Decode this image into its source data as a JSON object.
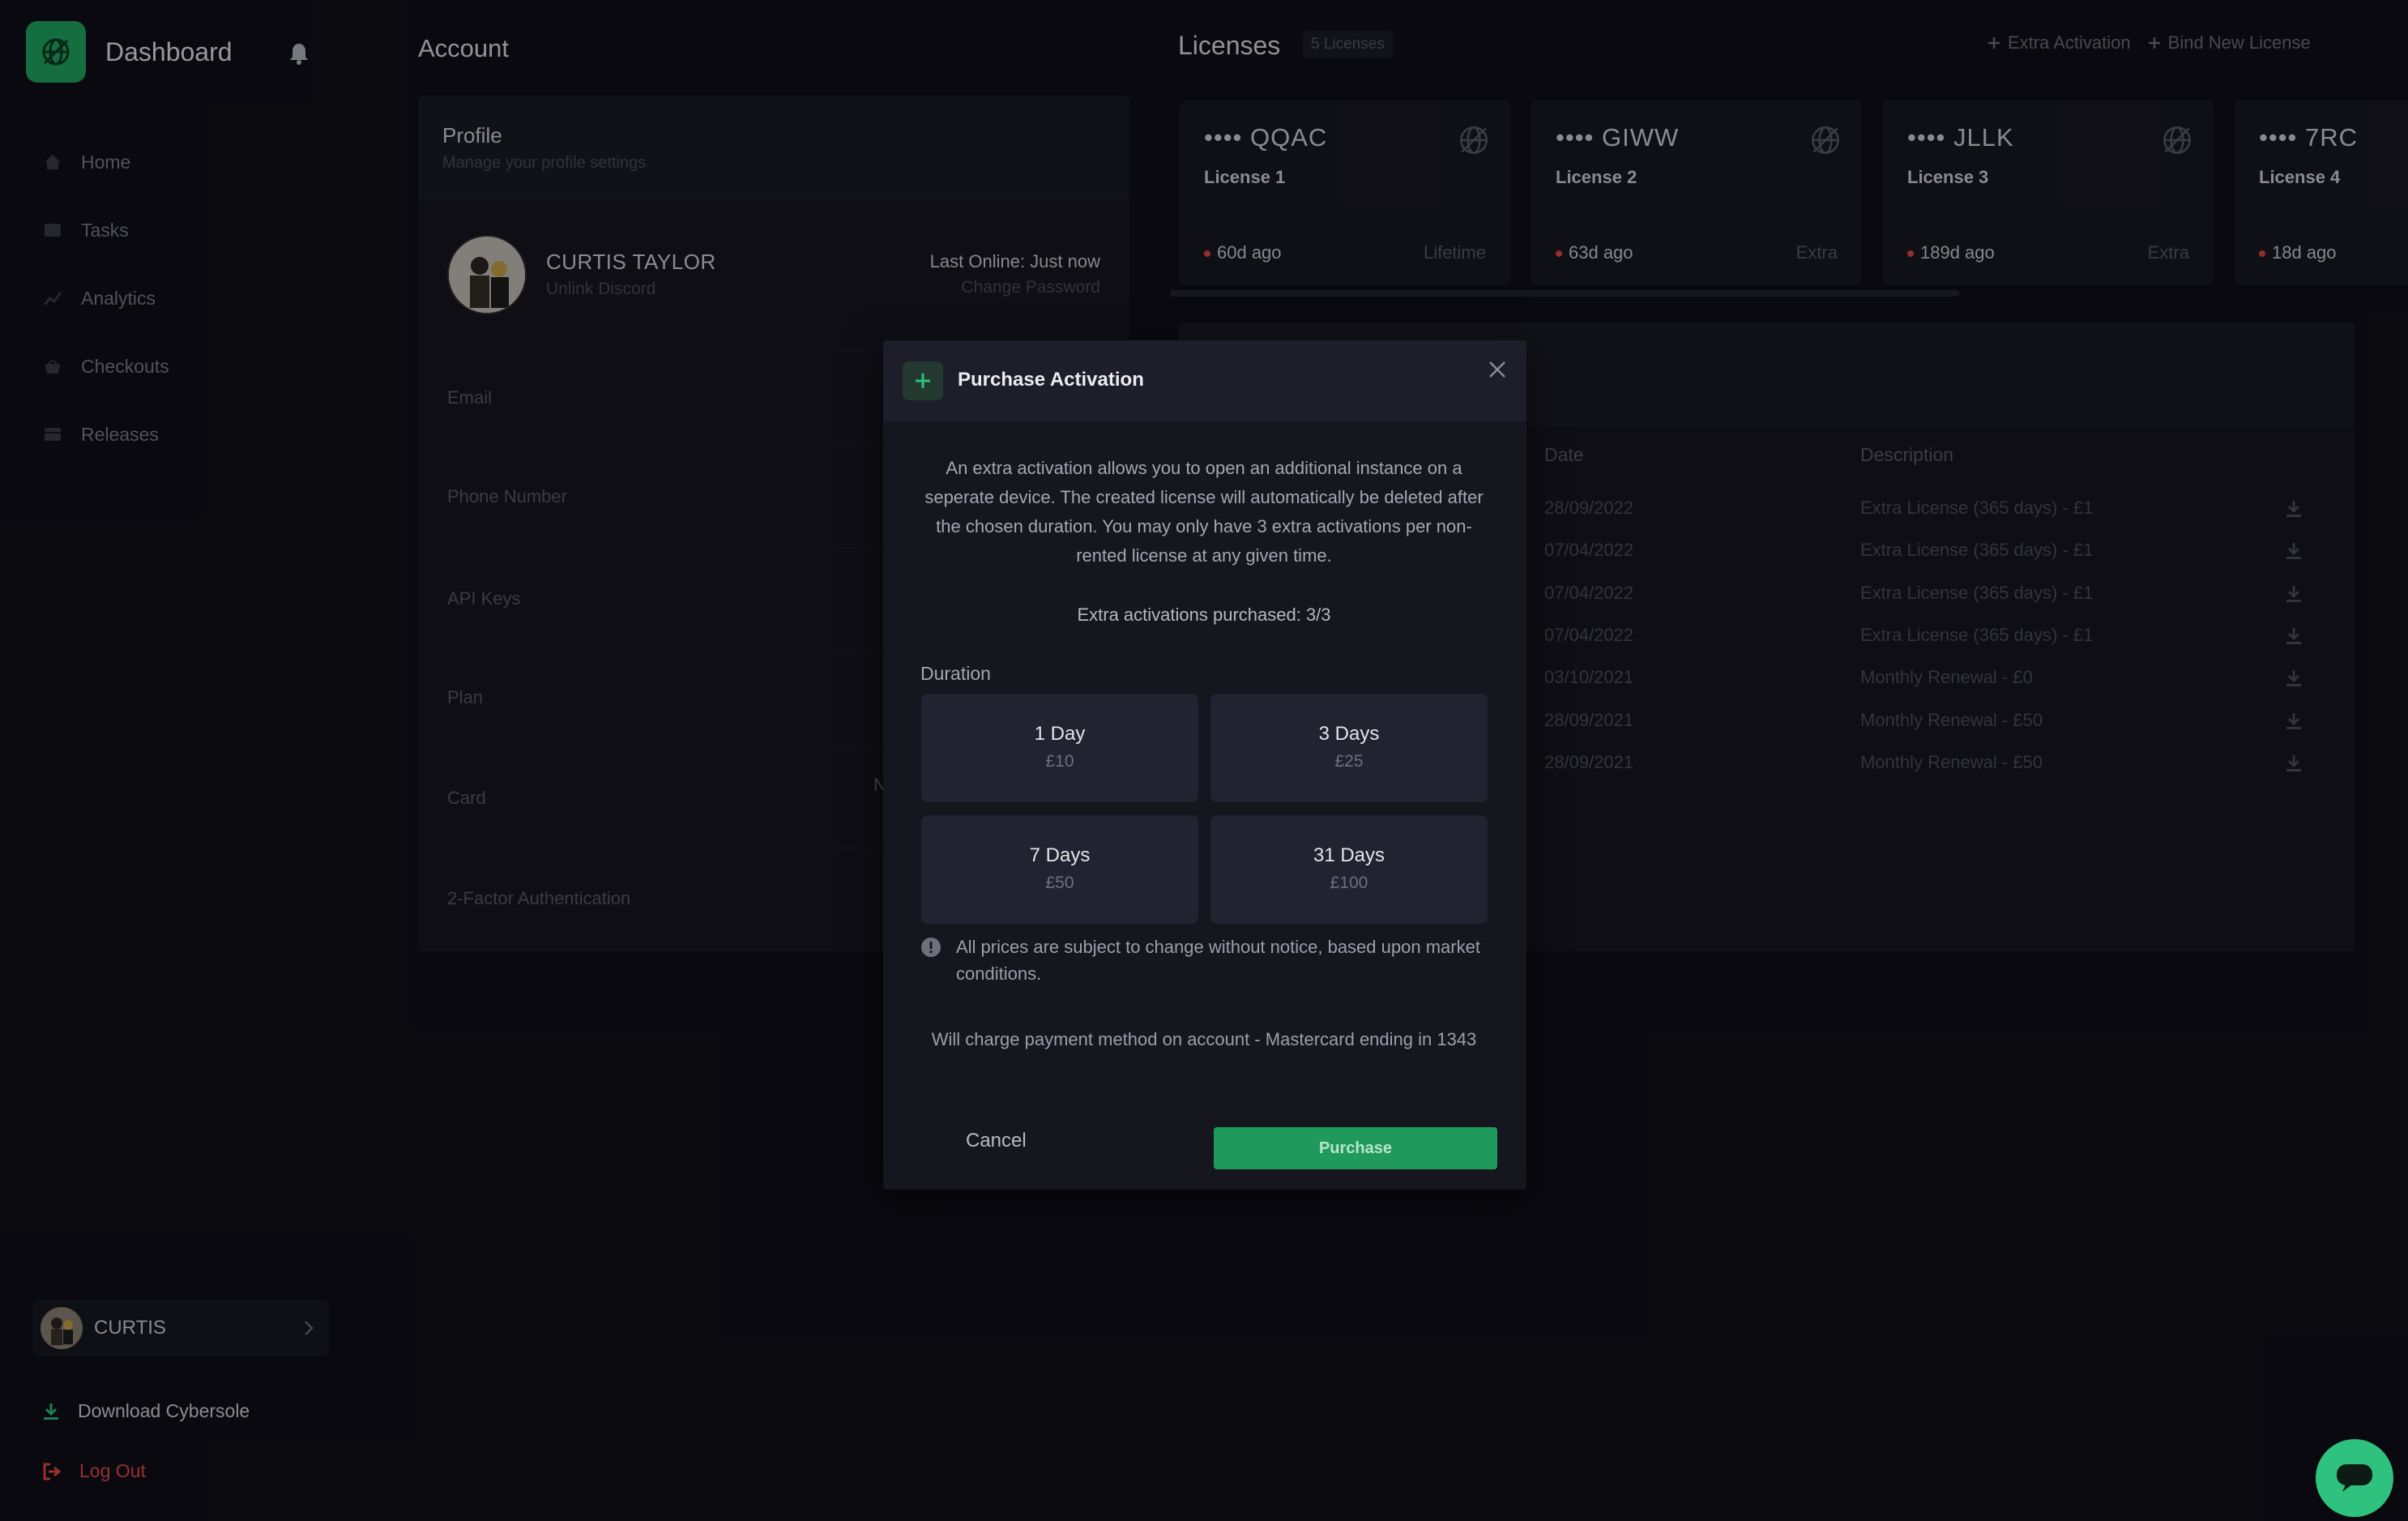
{
  "sidebar": {
    "brand": "Dashboard",
    "nav": [
      {
        "label": "Home",
        "icon": "home-icon"
      },
      {
        "label": "Tasks",
        "icon": "tasks-icon"
      },
      {
        "label": "Analytics",
        "icon": "analytics-icon"
      },
      {
        "label": "Checkouts",
        "icon": "checkouts-icon"
      },
      {
        "label": "Releases",
        "icon": "releases-icon"
      }
    ],
    "user_name": "CURTIS",
    "download_label": "Download Cybersole",
    "logout_label": "Log Out"
  },
  "account": {
    "title": "Account",
    "profile_title": "Profile",
    "profile_subtitle": "Manage your profile settings",
    "full_name": "CURTIS TAYLOR",
    "unlink_label": "Unlink Discord",
    "last_online": "Last Online: Just now",
    "change_password": "Change Password",
    "fields": [
      "Email",
      "Phone Number",
      "API Keys",
      "Plan",
      "Card",
      "2-Factor Authentication"
    ],
    "card_partial": "N"
  },
  "licenses": {
    "title": "Licenses",
    "count_badge": "5 Licenses",
    "extra_activation_label": "Extra Activation",
    "bind_label": "Bind New License",
    "cards": [
      {
        "key": "•••• QQAC",
        "name": "License 1",
        "ago": "60d ago",
        "type": "Lifetime"
      },
      {
        "key": "•••• GIWW",
        "name": "License 2",
        "ago": "63d ago",
        "type": "Extra"
      },
      {
        "key": "•••• JLLK",
        "name": "License 3",
        "ago": "189d ago",
        "type": "Extra"
      },
      {
        "key": "•••• 7RC",
        "name": "License 4",
        "ago": "18d ago",
        "type": ""
      }
    ]
  },
  "history": {
    "date_header": "Date",
    "desc_header": "Description",
    "rows": [
      {
        "date": "28/09/2022",
        "desc": "Extra License (365 days) - £1"
      },
      {
        "date": "07/04/2022",
        "desc": "Extra License (365 days) - £1"
      },
      {
        "date": "07/04/2022",
        "desc": "Extra License (365 days) - £1"
      },
      {
        "date": "07/04/2022",
        "desc": "Extra License (365 days) - £1"
      },
      {
        "date": "03/10/2021",
        "desc": "Monthly Renewal - £0"
      },
      {
        "date": "28/09/2021",
        "desc": "Monthly Renewal - £50"
      },
      {
        "date": "28/09/2021",
        "desc": "Monthly Renewal - £50"
      }
    ]
  },
  "modal": {
    "title": "Purchase Activation",
    "description": "An extra activation allows you to open an additional instance on a seperate device. The created license will automatically be deleted after the chosen duration. You may only have 3 extra activations per non-rented license at any given time.",
    "purchased_count": "Extra activations purchased: 3/3",
    "duration_label": "Duration",
    "durations": [
      {
        "label": "1 Day",
        "price": "£10"
      },
      {
        "label": "3 Days",
        "price": "£25"
      },
      {
        "label": "7 Days",
        "price": "£50"
      },
      {
        "label": "31 Days",
        "price": "£100"
      }
    ],
    "notice": "All prices are subject to change without notice, based upon market conditions.",
    "charge_info": "Will charge payment method on account - Mastercard ending in 1343",
    "cancel_label": "Cancel",
    "purchase_label": "Purchase"
  },
  "colors": {
    "accent": "#1faa62",
    "background": "#0f0f17",
    "danger": "#e84b4b"
  }
}
